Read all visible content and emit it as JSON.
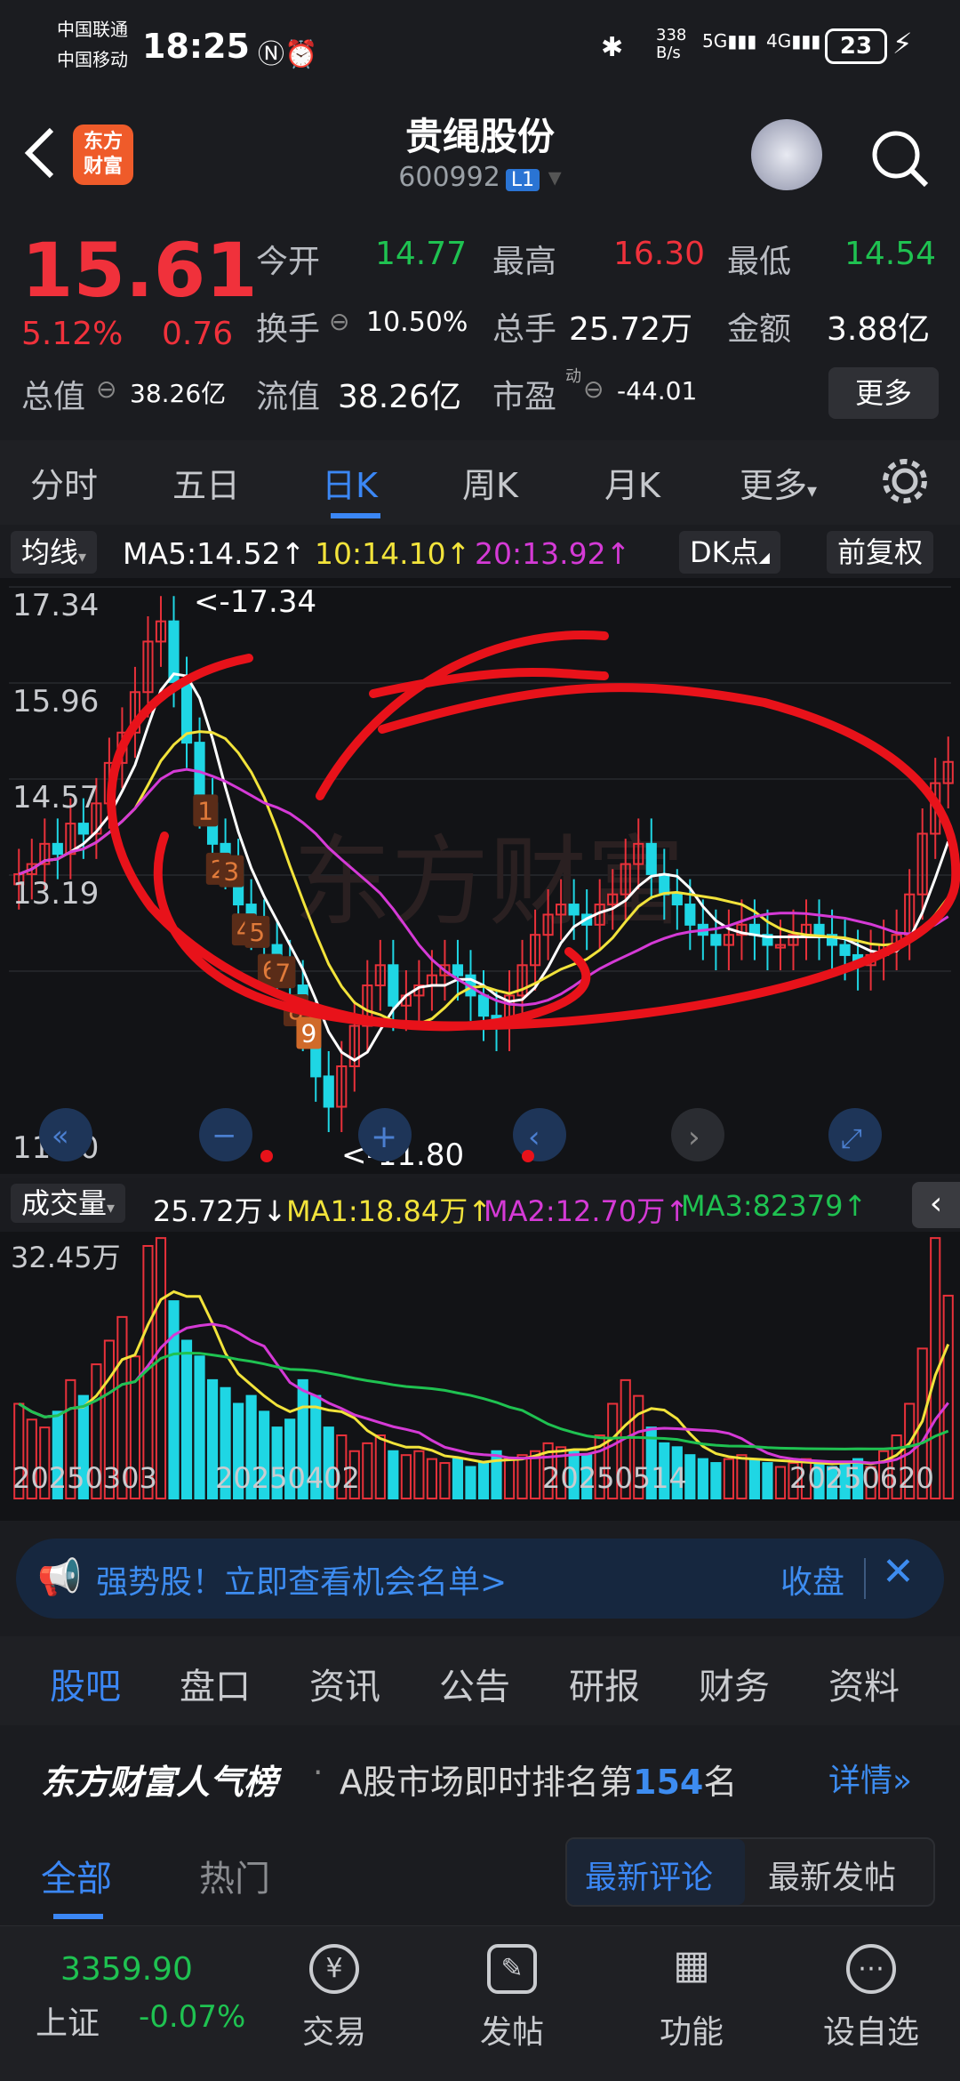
{
  "status_bar": {
    "carrier1": "中国联通",
    "carrier2": "中国移动",
    "time": "18:25",
    "net_speed_top": "338",
    "net_speed_unit": "B/s",
    "network": "5G",
    "network2": "4G",
    "battery": "23"
  },
  "header": {
    "logo_text_1": "东方",
    "logo_text_2": "财富",
    "stock_name": "贵绳股份",
    "stock_code": "600992",
    "level_tag": "L1"
  },
  "quote": {
    "price": "15.61",
    "change_pct": "5.12%",
    "change": "0.76",
    "open_label": "今开",
    "open": "14.77",
    "high_label": "最高",
    "high": "16.30",
    "low_label": "最低",
    "low": "14.54",
    "turnover_label": "换手",
    "turnover": "10.50%",
    "volume_label": "总手",
    "volume": "25.72万",
    "amount_label": "金额",
    "amount": "3.88亿",
    "mktcap_label": "总值",
    "mktcap": "38.26亿",
    "float_label": "流值",
    "float": "38.26亿",
    "pe_label": "市盈",
    "pe_sup": "动",
    "pe": "-44.01",
    "more": "更多"
  },
  "period_tabs": [
    "分时",
    "五日",
    "日K",
    "周K",
    "月K",
    "更多"
  ],
  "ma": {
    "chip": "均线",
    "ma5": "MA5:14.52↑",
    "ma10": "10:14.10↑",
    "ma20": "20:13.92↑",
    "dk": "DK点",
    "adjust": "前复权",
    "colors": {
      "ma5": "#ffffff",
      "ma10": "#f2e33b",
      "ma20": "#d53ad6"
    }
  },
  "kline": {
    "ticks": [
      "17.34",
      "15.96",
      "14.57",
      "13.19",
      "11.80"
    ],
    "max_annot": "<-17.34",
    "min_annot": "<-11.80",
    "seq_numbers": [
      "1",
      "2",
      "3",
      "4",
      "5",
      "6",
      "7",
      "8",
      "9"
    ],
    "watermark": "东方财富"
  },
  "volume": {
    "chip": "成交量",
    "value": "25.72万↓",
    "ma1": "MA1:18.84万↑",
    "ma2": "MA2:12.70万↑",
    "ma3": "MA3:82379↑",
    "top_tick": "32.45万",
    "dates": [
      "20250303",
      "20250402",
      "20250514",
      "20250620"
    ]
  },
  "banner": {
    "text": "强势股！立即查看机会名单>",
    "right": "收盘"
  },
  "content_tabs": [
    "股吧",
    "盘口",
    "资讯",
    "公告",
    "研报",
    "财务",
    "资料"
  ],
  "rank": {
    "title": "东方财富人气榜",
    "sep": "·",
    "text_pre": "A股市场即时排名第",
    "rank": "154",
    "text_post": "名",
    "detail": "详情"
  },
  "sub_tabs": {
    "all": "全部",
    "hot": "热门",
    "latest_comment": "最新评论",
    "latest_post": "最新发帖"
  },
  "bottom_nav": {
    "index_value": "3359.90",
    "index_name": "上证",
    "index_change": "-0.07%",
    "items": [
      "交易",
      "发帖",
      "功能",
      "设自选"
    ]
  }
}
